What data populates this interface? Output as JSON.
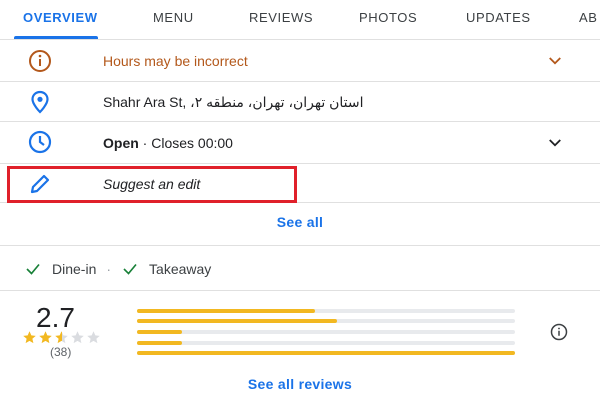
{
  "tabs": [
    {
      "label": "OVERVIEW",
      "active": true
    },
    {
      "label": "MENU"
    },
    {
      "label": "REVIEWS"
    },
    {
      "label": "PHOTOS"
    },
    {
      "label": "UPDATES"
    },
    {
      "label": "AB"
    }
  ],
  "details": {
    "hours_warning": "Hours may be incorrect",
    "address_latin": "Shahr Ara St",
    "address_persian": "استان تهران، تهران، منطقه ۲،",
    "open_status": "Open",
    "open_separator": " · ",
    "closes": "Closes 00:00",
    "suggest_edit": "Suggest an edit",
    "see_all": "See all"
  },
  "services": {
    "dine_in": "Dine-in",
    "separator": "·",
    "takeaway": "Takeaway"
  },
  "rating": {
    "value": "2.7",
    "count": "(38)",
    "stars_filled": 2.7,
    "distribution_fraction": [
      0.47,
      0.53,
      0.12,
      0.12,
      1.0
    ],
    "see_all_reviews": "See all reviews"
  },
  "colors": {
    "accent": "#1a73e8",
    "warning": "#b3581b",
    "star": "#f2b821",
    "check": "#188038",
    "highlight_box": "#e0202a"
  },
  "icons": {
    "hours_warning": "info-circle-icon",
    "address": "location-pin-icon",
    "hours": "clock-icon",
    "suggest_edit": "pencil-icon",
    "info": "info-icon",
    "check": "check-icon",
    "expand": "chevron-down-icon"
  }
}
